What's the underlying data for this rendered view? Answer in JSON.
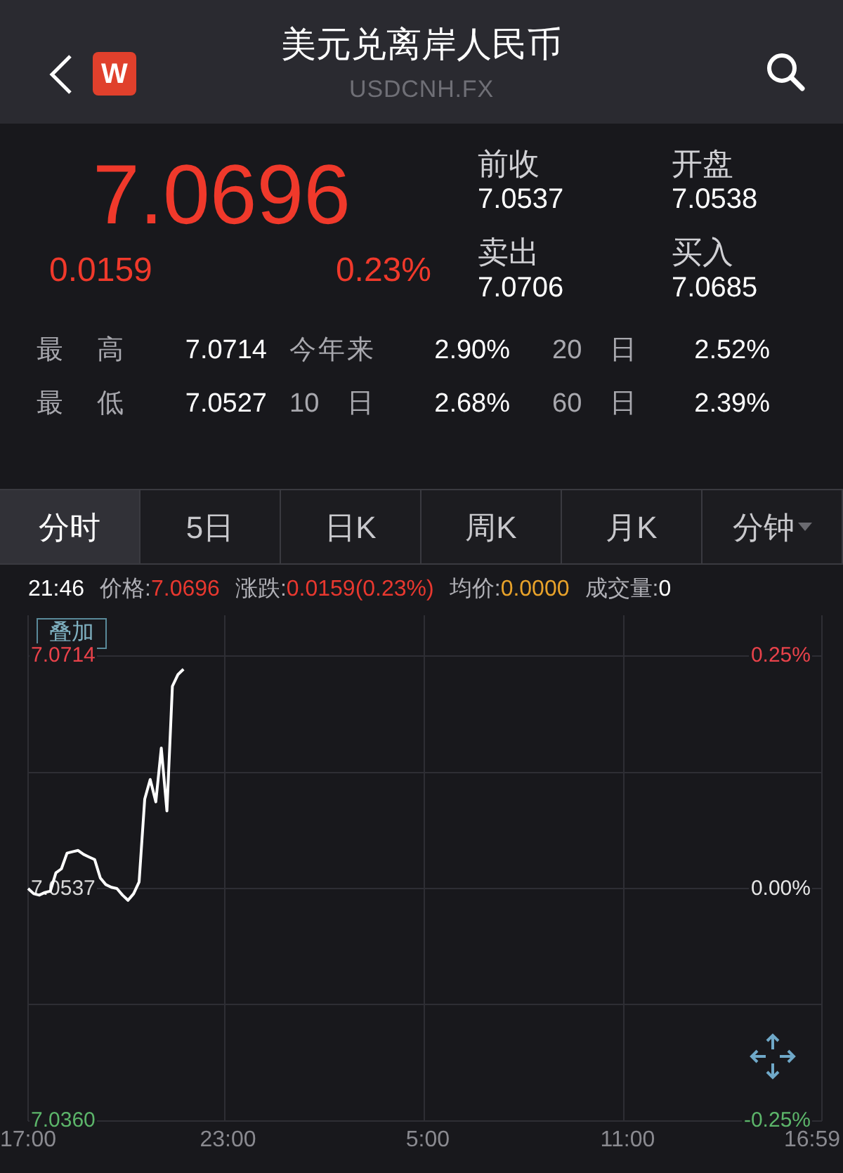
{
  "header": {
    "title": "美元兑离岸人民币",
    "subtitle": "USDCNH.FX",
    "badge": "W"
  },
  "quote": {
    "price": "7.0696",
    "change": "0.0159",
    "change_pct": "0.23%",
    "color": "#f0392b"
  },
  "quote_fields": [
    {
      "label": "前收",
      "value": "7.0537"
    },
    {
      "label": "开盘",
      "value": "7.0538"
    },
    {
      "label": "卖出",
      "value": "7.0706"
    },
    {
      "label": "买入",
      "value": "7.0685"
    }
  ],
  "stats": [
    [
      {
        "label": "最 高",
        "value": "7.0714"
      },
      {
        "label": "今年来",
        "value": "2.90%"
      },
      {
        "label": "20 日",
        "value": "2.52%"
      }
    ],
    [
      {
        "label": "最 低",
        "value": "7.0527"
      },
      {
        "label": "10 日",
        "value": "2.68%"
      },
      {
        "label": "60 日",
        "value": "2.39%"
      }
    ]
  ],
  "tabs": [
    {
      "label": "分时",
      "selected": true,
      "dropdown": false
    },
    {
      "label": "5日",
      "selected": false,
      "dropdown": false
    },
    {
      "label": "日K",
      "selected": false,
      "dropdown": false
    },
    {
      "label": "周K",
      "selected": false,
      "dropdown": false
    },
    {
      "label": "月K",
      "selected": false,
      "dropdown": false
    },
    {
      "label": "分钟",
      "selected": false,
      "dropdown": true
    }
  ],
  "info_bar": {
    "time": "21:46",
    "items": [
      {
        "label": "价格:",
        "value": "7.0696",
        "color": "#e8382f"
      },
      {
        "label": "涨跌:",
        "value": "0.0159(0.23%)",
        "color": "#e8382f"
      },
      {
        "label": "均价:",
        "value": "0.0000",
        "color": "#e8a22a"
      },
      {
        "label": "成交量:",
        "value": "0",
        "color": "#ffffff"
      }
    ]
  },
  "chart": {
    "overlay_button": "叠加",
    "percent_labels": [
      {
        "text": "0.25%",
        "color": "#e8424a"
      },
      {
        "text": "0.00%",
        "color": "#e6e6e6"
      },
      {
        "text": "-0.25%",
        "color": "#5cb56a"
      }
    ],
    "chart_data": {
      "type": "line",
      "categories": [
        "17:00",
        null,
        null,
        null,
        null,
        null,
        null,
        null,
        null,
        null,
        null,
        null,
        null,
        null,
        null,
        null,
        null,
        null,
        null,
        null,
        null,
        null,
        null,
        null,
        null,
        null,
        null,
        null,
        null,
        null,
        null,
        null,
        null,
        null,
        null,
        null,
        "23:00",
        null,
        null,
        null,
        null,
        null,
        null,
        null,
        null,
        null,
        null,
        null,
        null,
        null,
        null,
        null,
        null,
        null,
        null,
        null,
        null,
        null,
        null,
        null,
        null,
        null,
        null,
        null,
        null,
        null,
        null,
        null,
        null,
        null,
        null,
        null,
        "5:00",
        null,
        null,
        null,
        null,
        null,
        null,
        null,
        null,
        null,
        null,
        null,
        null,
        null,
        null,
        null,
        null,
        null,
        null,
        null,
        null,
        null,
        null,
        null,
        null,
        null,
        null,
        null,
        null,
        null,
        null,
        null,
        null,
        null,
        null,
        null,
        "11:00",
        null,
        null,
        null,
        null,
        null,
        null,
        null,
        null,
        null,
        null,
        null,
        null,
        null,
        null,
        null,
        null,
        null,
        null,
        null,
        null,
        null,
        null,
        null,
        null,
        null,
        null,
        null,
        null,
        null,
        null,
        null,
        null,
        null,
        null,
        "16:59"
      ],
      "series": [
        {
          "color": "#ffffff",
          "values": [
            7.0537,
            7.0533,
            7.0532,
            7.0534,
            7.0535,
            7.0549,
            7.0552,
            7.0564,
            7.0565,
            7.0566,
            7.0563,
            7.0561,
            7.0559,
            7.0545,
            7.054,
            7.0538,
            7.0537,
            7.0532,
            7.0528,
            7.0533,
            7.0542,
            7.0605,
            7.062,
            7.0603,
            7.0644,
            7.0596,
            7.0691,
            7.07,
            7.0704,
            null,
            null,
            null,
            null,
            null,
            null,
            null,
            null,
            null,
            null,
            null,
            null,
            null,
            null,
            null,
            null,
            null,
            null,
            null,
            null,
            null,
            null,
            null,
            null,
            null,
            null,
            null,
            null,
            null,
            null,
            null,
            null,
            null,
            null,
            null,
            null,
            null,
            null,
            null,
            null,
            null,
            null,
            null,
            null,
            null,
            null,
            null,
            null,
            null,
            null,
            null,
            null,
            null,
            null,
            null,
            null,
            null,
            null,
            null,
            null,
            null,
            null,
            null,
            null,
            null,
            null,
            null,
            null,
            null,
            null,
            null,
            null,
            null,
            null,
            null,
            null,
            null,
            null,
            null,
            null,
            null,
            null,
            null,
            null,
            null,
            null,
            null,
            null,
            null,
            null,
            null,
            null,
            null,
            null,
            null,
            null,
            null,
            null,
            null,
            null,
            null,
            null,
            null,
            null,
            null,
            null,
            null,
            null,
            null,
            null,
            null,
            null,
            null,
            null,
            null
          ]
        }
      ],
      "ylim": [
        7.036,
        7.0714
      ],
      "yticks": [
        {
          "value": 7.0714,
          "label": "7.0714"
        },
        {
          "value": 7.0537,
          "label": "7.0537"
        },
        {
          "value": 7.036,
          "label": "7.0360"
        }
      ]
    }
  }
}
